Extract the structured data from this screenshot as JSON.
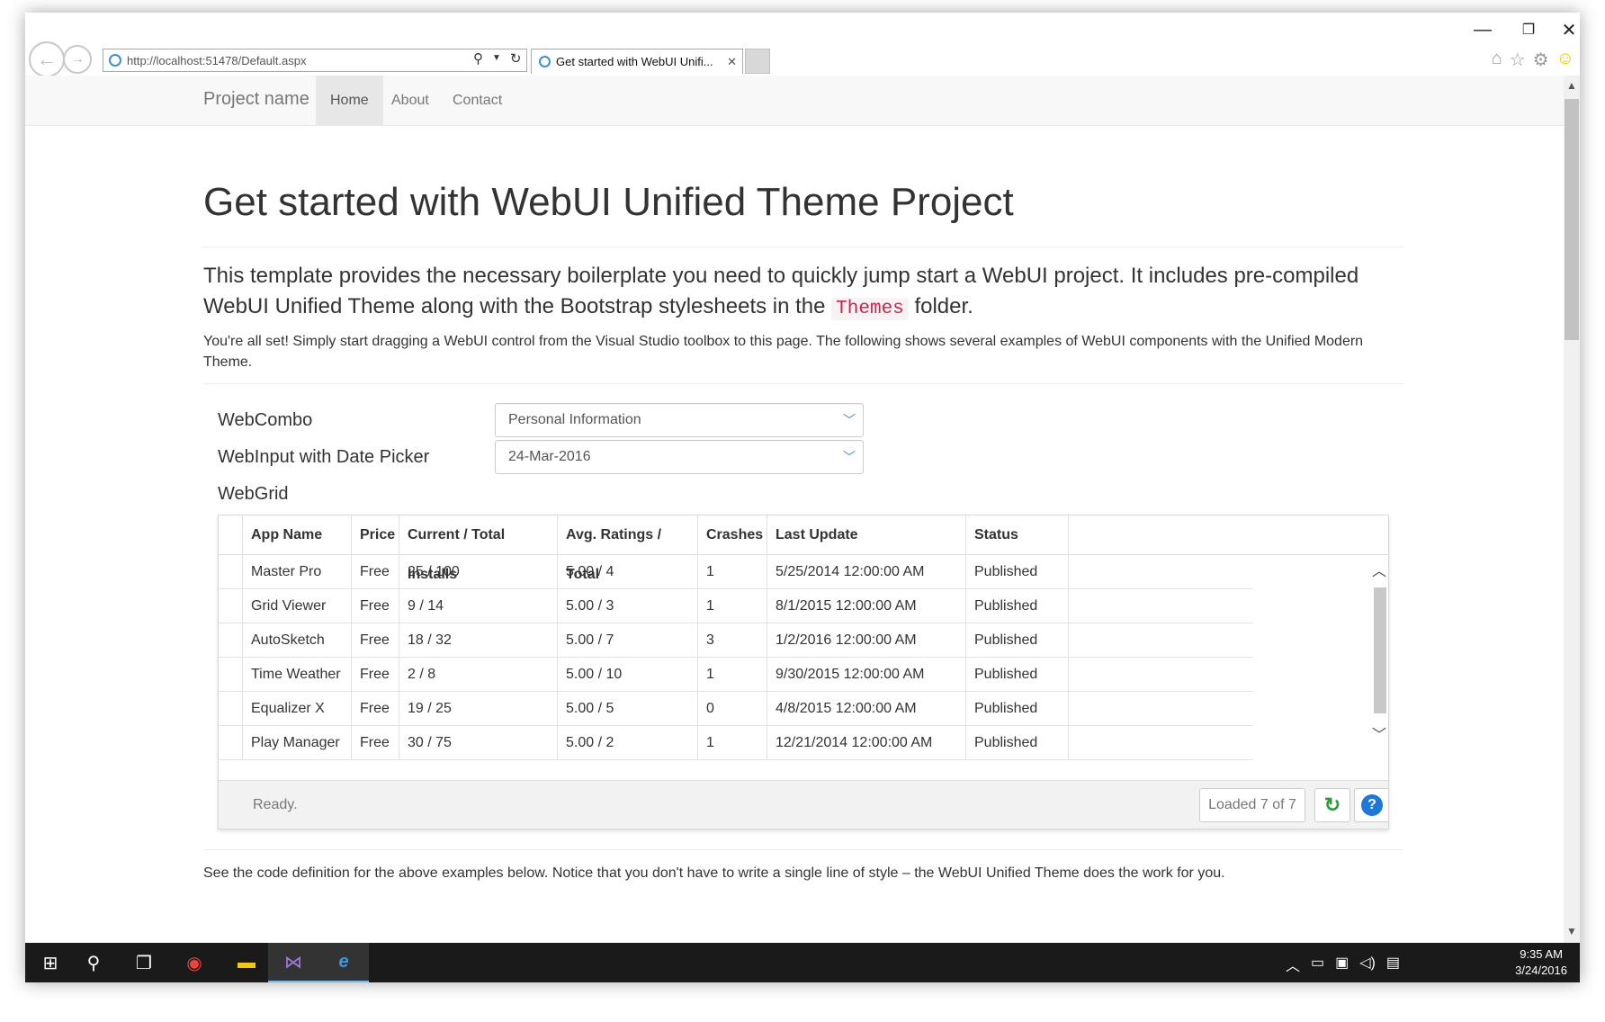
{
  "browser": {
    "url": "http://localhost:51478/Default.aspx",
    "tab_title": "Get started with WebUI Unifi...",
    "minimize": "—",
    "restore": "❐",
    "close": "✕"
  },
  "navbar": {
    "brand": "Project name",
    "links": [
      {
        "label": "Home",
        "active": true
      },
      {
        "label": "About",
        "active": false
      },
      {
        "label": "Contact",
        "active": false
      }
    ]
  },
  "page": {
    "title": "Get started with WebUI Unified Theme Project",
    "lead_before": "This template provides the necessary boilerplate you need to quickly jump start a WebUI project. It includes pre-compiled WebUI Unified Theme along with the Bootstrap stylesheets in the ",
    "lead_code": "Themes",
    "lead_after": " folder.",
    "paragraph": "You're all set! Simply start dragging a WebUI control from the Visual Studio toolbox to this page. The following shows several examples of WebUI components with the Unified Modern Theme.",
    "paragraph2": "See the code definition for the above examples below. Notice that you don't have to write a single line of style – the WebUI Unified Theme does the work for you."
  },
  "form": {
    "webcombo_label": "WebCombo",
    "webcombo_value": "Personal Information",
    "webinput_label": "WebInput with Date Picker",
    "webinput_value": "24-Mar-2016",
    "webgrid_label": "WebGrid"
  },
  "grid": {
    "columns": [
      "App Name",
      "Price",
      "Current / Total Installs",
      "Avg. Ratings / Total",
      "Crashes",
      "Last Update",
      "Status"
    ],
    "rows": [
      [
        "Master Pro",
        "Free",
        "25 / 100",
        "5.00 / 4",
        "1",
        "5/25/2014 12:00:00 AM",
        "Published"
      ],
      [
        "Grid Viewer",
        "Free",
        "9 / 14",
        "5.00 / 3",
        "1",
        "8/1/2015 12:00:00 AM",
        "Published"
      ],
      [
        "AutoSketch",
        "Free",
        "18 / 32",
        "5.00 / 7",
        "3",
        "1/2/2016 12:00:00 AM",
        "Published"
      ],
      [
        "Time Weather",
        "Free",
        "2 / 8",
        "5.00 / 10",
        "1",
        "9/30/2015 12:00:00 AM",
        "Published"
      ],
      [
        "Equalizer X",
        "Free",
        "19 / 25",
        "5.00 / 5",
        "0",
        "4/8/2015 12:00:00 AM",
        "Published"
      ],
      [
        "Play Manager",
        "Free",
        "30 / 75",
        "5.00 / 2",
        "1",
        "12/21/2014 12:00:00 AM",
        "Published"
      ]
    ],
    "status": "Ready.",
    "loaded": "Loaded 7 of 7"
  },
  "taskbar": {
    "time": "9:35 AM",
    "date": "3/24/2016"
  },
  "colors": {
    "accent": "#1e78d6",
    "code": "#c7254e",
    "refresh": "#2a9a3a"
  }
}
